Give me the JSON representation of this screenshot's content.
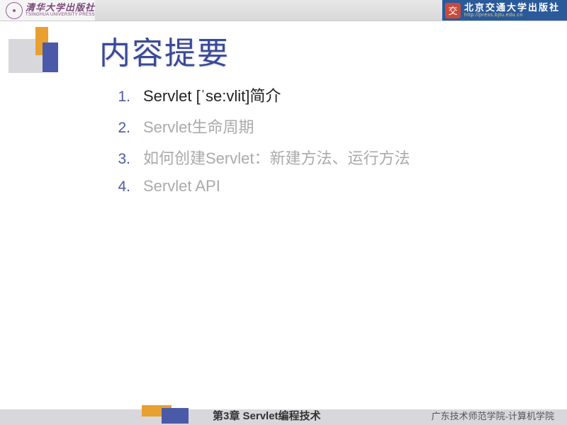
{
  "header": {
    "left_logo": {
      "cn": "清华大学出版社",
      "en": "TSINGHUA UNIVERSITY PRESS"
    },
    "right_logo": {
      "cn": "北京交通大学出版社",
      "en": "http://press.bjtu.edu.cn"
    }
  },
  "title": "内容提要",
  "items": [
    {
      "num": "1.",
      "text": "Servlet [ˈse:vlit]简介",
      "active": true
    },
    {
      "num": "2.",
      "text": "Servlet生命周期",
      "active": false
    },
    {
      "num": "3.",
      "text": "如何创建Servlet：新建方法、运行方法",
      "active": false
    },
    {
      "num": "4.",
      "text": "Servlet API",
      "active": false
    }
  ],
  "footer": {
    "chapter": "第3章 Servlet编程技术",
    "school": "广东技术师范学院-计算机学院"
  }
}
